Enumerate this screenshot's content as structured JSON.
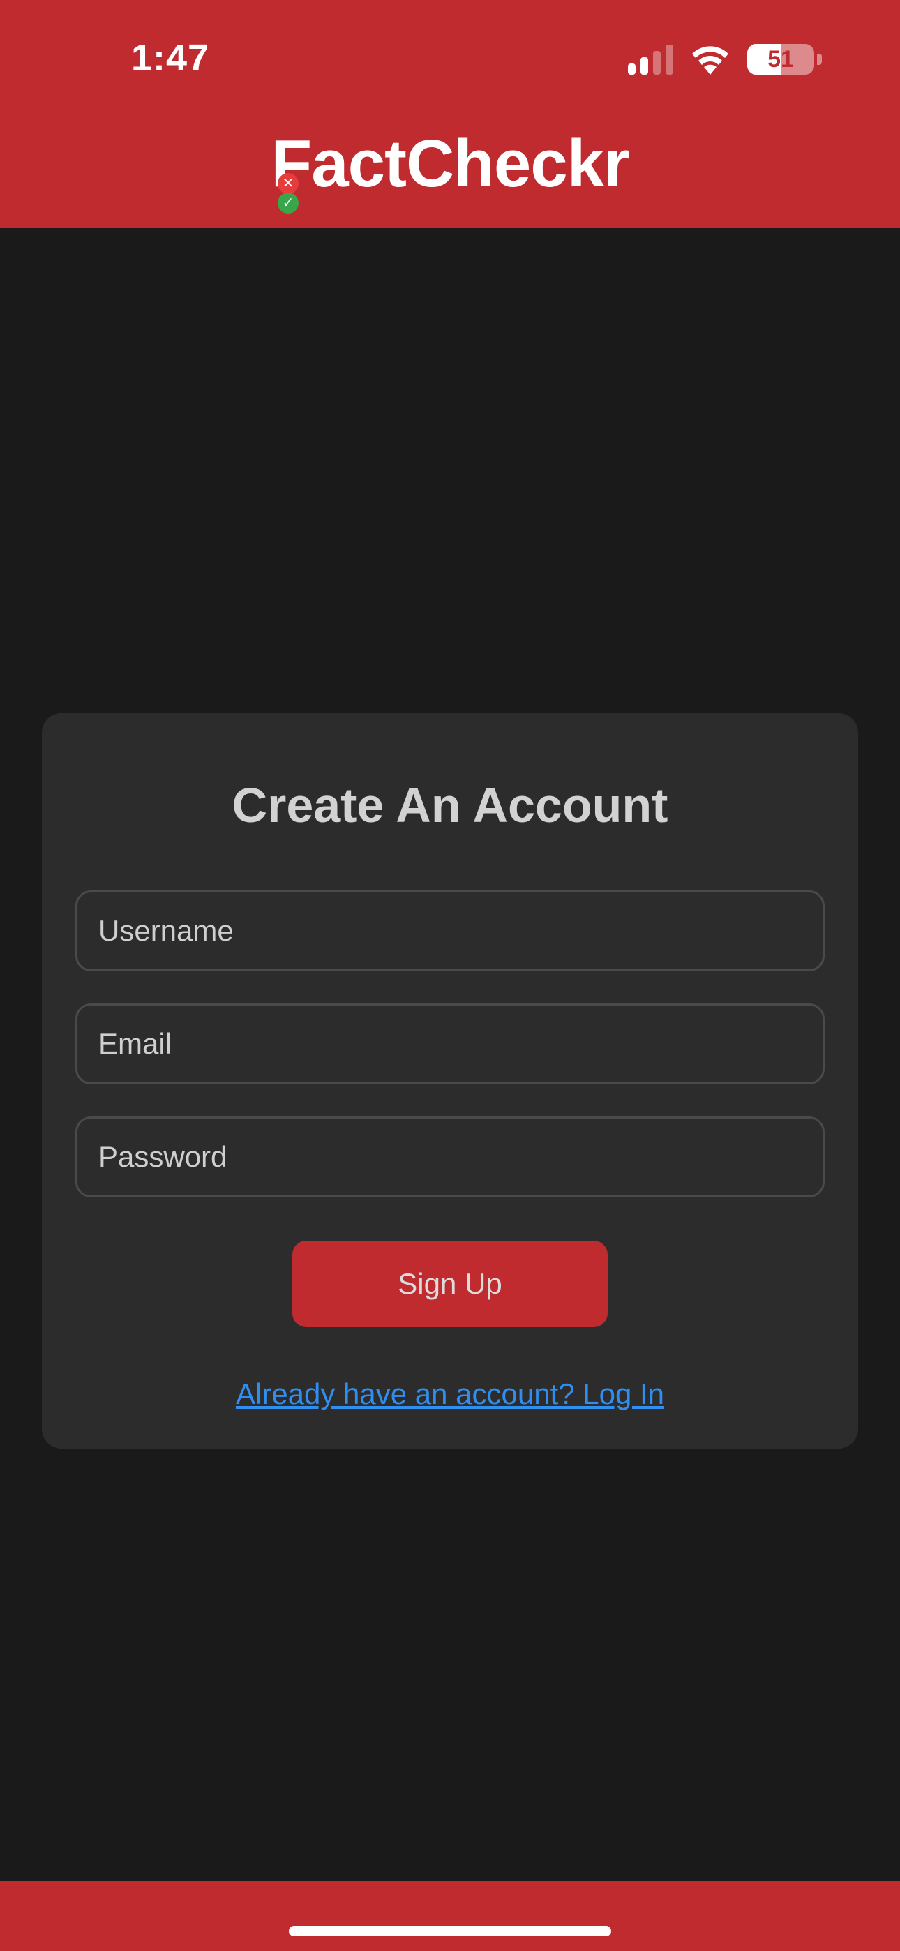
{
  "status_bar": {
    "time": "1:47",
    "battery_percent": "51",
    "battery_level": 0.51,
    "signal_bars_active": 2,
    "signal_bars_total": 4
  },
  "header": {
    "logo_text": "FactCheckr",
    "background_color": "#bf2b2e"
  },
  "signup_form": {
    "title": "Create An Account",
    "username_placeholder": "Username",
    "email_placeholder": "Email",
    "password_placeholder": "Password",
    "submit_label": "Sign Up",
    "login_link": "Already have an account? Log In"
  },
  "colors": {
    "accent": "#bf2b2e",
    "background": "#1a1a1a",
    "card": "#2c2c2c",
    "link": "#2f8ef0"
  },
  "icons": [
    "signal-icon",
    "wifi-icon",
    "battery-icon",
    "x-badge-icon",
    "check-badge-icon"
  ]
}
